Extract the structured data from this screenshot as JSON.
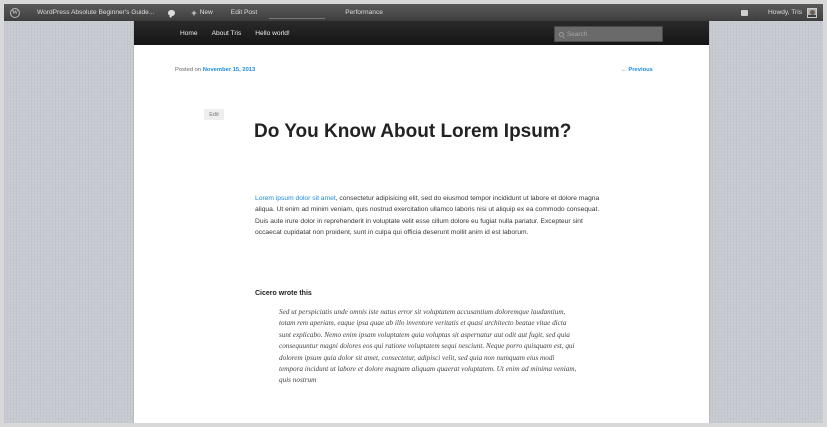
{
  "admin_bar": {
    "site_name": "WordPress Absolute Beginner's Guide...",
    "new_label": "New",
    "edit_post_label": "Edit Post",
    "performance_label": "Performance",
    "howdy_label": "Howdy, Tris"
  },
  "theme_nav": {
    "items": [
      "Home",
      "About Tris",
      "Hello world!"
    ],
    "search_placeholder": "Search"
  },
  "post": {
    "meta_prefix": "Posted on",
    "date": "November 15, 2013",
    "previous_label": "← Previous",
    "edit_label": "Edit",
    "title": "Do You Know About Lorem Ipsum?",
    "lead_link_text": "Lorem ipsum dolor sit amet",
    "body_rest": ", consectetur adipisicing elit, sed do eiusmod tempor incididunt ut labore et dolore magna aliqua. Ut enim ad minim veniam, quis nostrud exercitation ullamco laboris nisi ut aliquip ex ea commodo consequat. Duis aute irure dolor in reprehenderit in voluptate velit esse cillum dolore eu fugiat nulla pariatur. Excepteur sint occaecat cupidatat non proident, sunt in culpa qui officia deserunt mollit anim id est laborum.",
    "subhead": "Cicero wrote this",
    "quote": "Sed ut perspiciatis unde omnis iste natus error sit voluptatem accusantium doloremque laudantium, totam rem aperiam, eaque ipsa quae ab illo inventore veritatis et quasi architecto beatae vitae dicta sunt explicabo. Nemo enim ipsam voluptatem quia voluptas sit aspernatur aut odit aut fugit, sed quia consequuntur magni dolores eos qui ratione voluptatem sequi nesciunt. Neque porro quisquam est, qui dolorem ipsum quia dolor sit amet, consectetur, adipisci velit, sed quia non numquam eius modi tempora incidunt ut labore et dolore magnam aliquam quaerat voluptatem. Ut enim ad minima veniam, quis nostrum"
  }
}
